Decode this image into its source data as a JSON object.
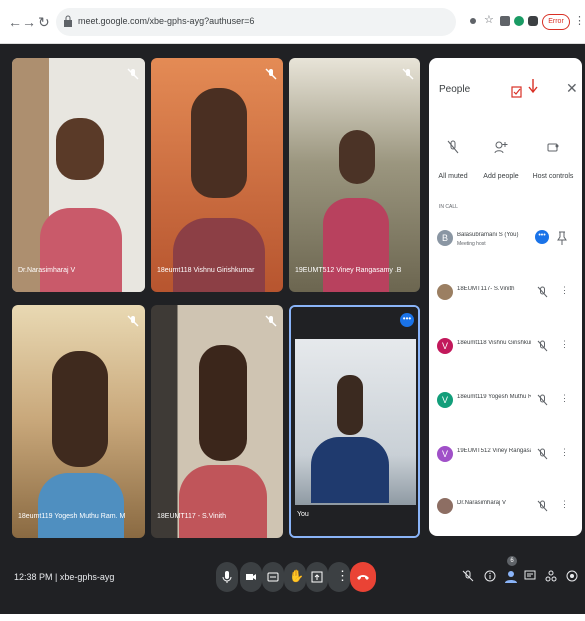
{
  "browser": {
    "url": "meet.google.com/xbe-gphs-ayg?authuser=6",
    "error_label": "Error"
  },
  "tiles": [
    {
      "name": "Dr.Narasimharaj V",
      "bg": "#c7c4b8"
    },
    {
      "name": "18eumt118 Vishnu Girishkumar",
      "bg": "#d7794a"
    },
    {
      "name": "19EUMT512 Viney Rangasamy .B",
      "bg": "#8a8572"
    },
    {
      "name": "18eumt119 Yogesh Muthu Ram. M",
      "bg": "#c8a77a"
    },
    {
      "name": "18EUMT117 - S.Vinith",
      "bg": "#b8ab96"
    },
    {
      "name": "You",
      "bg": "#aab0b4"
    }
  ],
  "panel": {
    "title": "People",
    "actions": [
      {
        "label": "All muted"
      },
      {
        "label": "Add people"
      },
      {
        "label": "Host controls"
      }
    ],
    "section": "IN CALL",
    "participants": [
      {
        "name": "Balasubramani S (You)",
        "sub": "Meeting host",
        "initial": "B",
        "color": "#8a96a3"
      },
      {
        "name": "18EUMT117- S.Vinith",
        "sub": "",
        "initial": "",
        "color": "#9b7f62"
      },
      {
        "name": "18eumt118 Vishnu Girishkumar",
        "sub": "",
        "initial": "V",
        "color": "#c2185b"
      },
      {
        "name": "18eumt119 Yogesh Muthu Ram. M",
        "sub": "",
        "initial": "V",
        "color": "#129e7a"
      },
      {
        "name": "19EUMT512 Viney Rangasamy .B",
        "sub": "",
        "initial": "V",
        "color": "#a050c8"
      },
      {
        "name": "Dr.Narasimharaj V",
        "sub": "",
        "initial": "",
        "color": "#8d6e63"
      }
    ]
  },
  "bottom": {
    "time": "12:38 PM",
    "meeting_code": "xbe-gphs-ayg",
    "people_count": "6"
  }
}
